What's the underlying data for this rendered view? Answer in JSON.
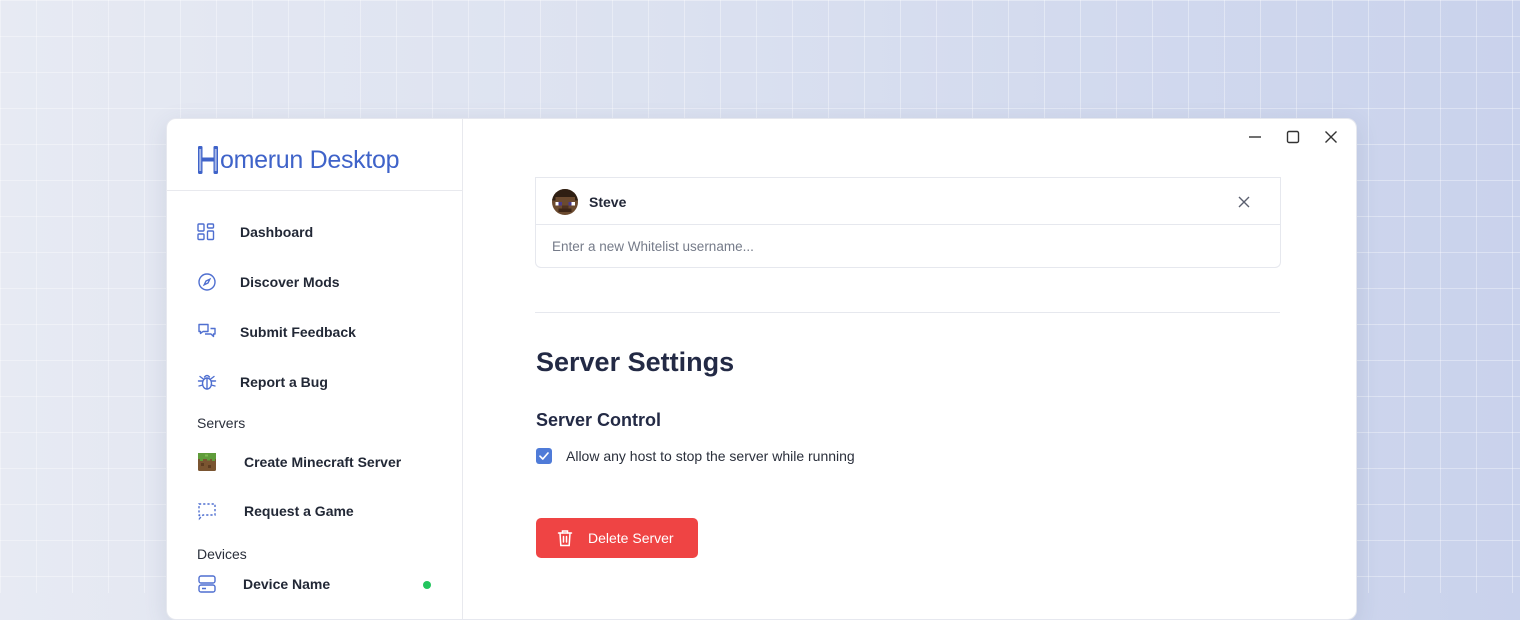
{
  "app": {
    "title": "Homerun Desktop",
    "logo_letter": "H",
    "logo_rest": "omerun Desktop"
  },
  "sidebar": {
    "nav": [
      {
        "label": "Dashboard",
        "icon": "grid-icon"
      },
      {
        "label": "Discover Mods",
        "icon": "compass-icon"
      },
      {
        "label": "Submit Feedback",
        "icon": "chat-bubbles-icon"
      },
      {
        "label": "Report a Bug",
        "icon": "bug-icon"
      }
    ],
    "servers_heading": "Servers",
    "servers": [
      {
        "label": "Create Minecraft Server",
        "icon": "minecraft-grass-block-icon"
      },
      {
        "label": "Request a Game",
        "icon": "dashed-chat-bubble-icon"
      }
    ],
    "devices_heading": "Devices",
    "devices": [
      {
        "label": "Device Name",
        "icon": "server-icon",
        "status": "online",
        "status_color": "#22c55e"
      }
    ]
  },
  "window_controls": [
    "minimize-icon",
    "maximize-icon",
    "close-icon"
  ],
  "whitelist": {
    "entries": [
      {
        "username": "Steve",
        "icon": "steve-avatar"
      }
    ],
    "input_placeholder": "Enter a new Whitelist username..."
  },
  "settings": {
    "title": "Server Settings",
    "control_heading": "Server Control",
    "allow_stop_label": "Allow any host to stop the server while running",
    "allow_stop_checked": true,
    "delete_label": "Delete Server"
  },
  "colors": {
    "accent": "#4f7bd8",
    "brand": "#3f63c9",
    "danger": "#ef4444",
    "online": "#22c55e"
  }
}
